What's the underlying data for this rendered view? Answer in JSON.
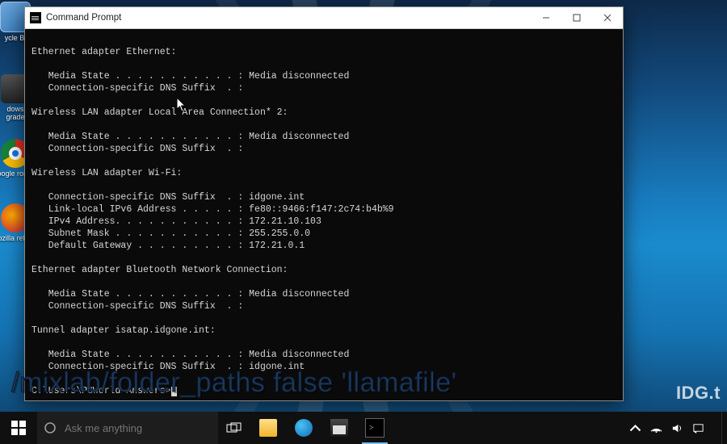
{
  "desktop_icons": {
    "recycle": "ycle Bi",
    "windows_shortcut": "dows\ngrade",
    "chrome": "oogle\nrome",
    "firefox": "ozilla\nrefox"
  },
  "window": {
    "title": "Command Prompt",
    "prompt": "C:\\Users\\PCWorld Answers>"
  },
  "ipconfig": {
    "sections": [
      {
        "header": "Ethernet adapter Ethernet:",
        "rows": [
          [
            "Media State . . . . . . . . . . . :",
            "Media disconnected"
          ],
          [
            "Connection-specific DNS Suffix  . :",
            ""
          ]
        ]
      },
      {
        "header": "Wireless LAN adapter Local Area Connection* 2:",
        "rows": [
          [
            "Media State . . . . . . . . . . . :",
            "Media disconnected"
          ],
          [
            "Connection-specific DNS Suffix  . :",
            ""
          ]
        ]
      },
      {
        "header": "Wireless LAN adapter Wi-Fi:",
        "rows": [
          [
            "Connection-specific DNS Suffix  . :",
            "idgone.int"
          ],
          [
            "Link-local IPv6 Address . . . . . :",
            "fe80::9466:f147:2c74:b4b%9"
          ],
          [
            "IPv4 Address. . . . . . . . . . . :",
            "172.21.10.103"
          ],
          [
            "Subnet Mask . . . . . . . . . . . :",
            "255.255.0.0"
          ],
          [
            "Default Gateway . . . . . . . . . :",
            "172.21.0.1"
          ]
        ]
      },
      {
        "header": "Ethernet adapter Bluetooth Network Connection:",
        "rows": [
          [
            "Media State . . . . . . . . . . . :",
            "Media disconnected"
          ],
          [
            "Connection-specific DNS Suffix  . :",
            ""
          ]
        ]
      },
      {
        "header": "Tunnel adapter isatap.idgone.int:",
        "rows": [
          [
            "Media State . . . . . . . . . . . :",
            "Media disconnected"
          ],
          [
            "Connection-specific DNS Suffix  . :",
            "idgone.int"
          ]
        ]
      }
    ]
  },
  "overlay": {
    "caption": "/mixlab/folder_paths false 'llamafile'",
    "watermark": "IDG.t"
  },
  "taskbar": {
    "search_placeholder": "Ask me anything",
    "clock_time": "",
    "clock_date": ""
  }
}
